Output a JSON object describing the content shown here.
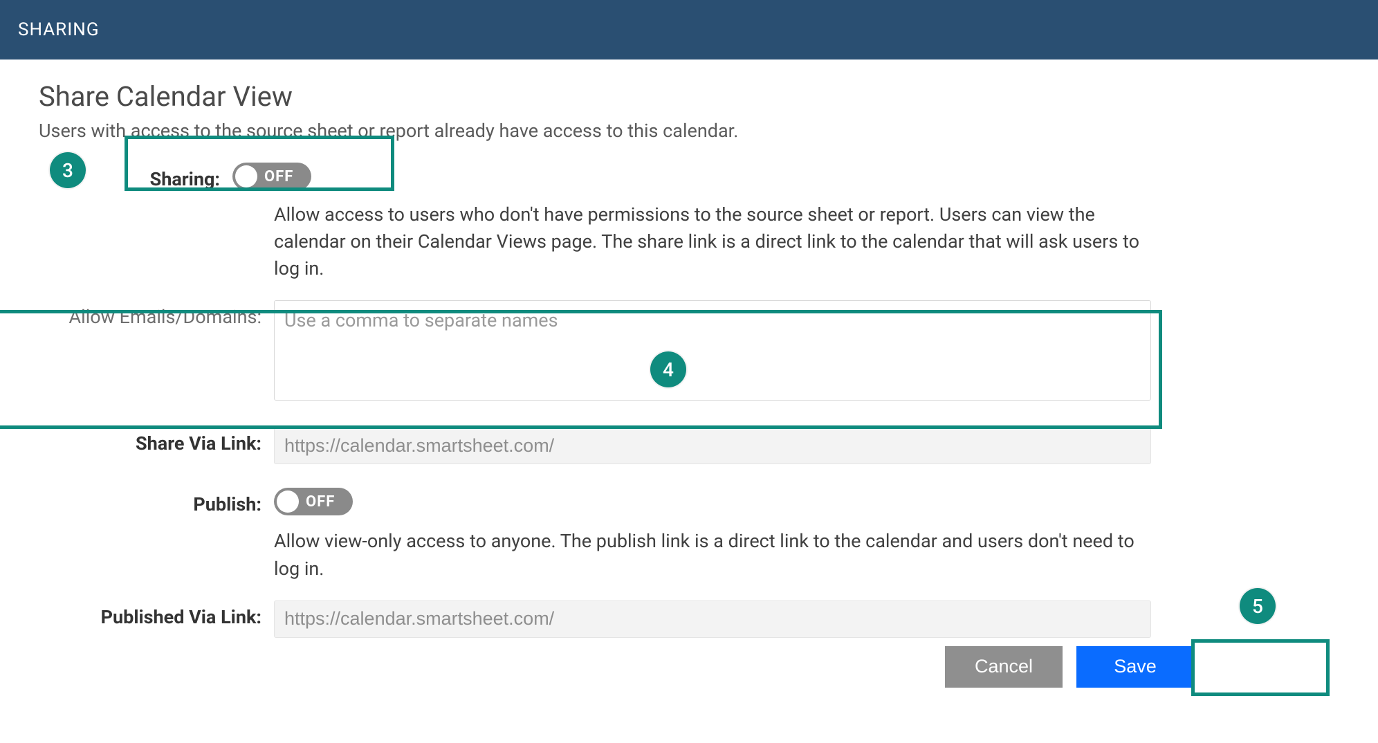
{
  "header": {
    "tab": "SHARING"
  },
  "title": "Share Calendar View",
  "subtitle": "Users with access to the source sheet or report already have access to this calendar.",
  "sharing": {
    "label": "Sharing:",
    "toggle": "OFF",
    "desc": "Allow access to users who don't have permissions to the source sheet or report. Users can view the calendar on their Calendar Views page. The share link is a direct link to the calendar that will ask users to log in."
  },
  "allow": {
    "label": "Allow Emails/Domains:",
    "placeholder": "Use a comma to separate names",
    "value": ""
  },
  "shareLink": {
    "label": "Share Via Link:",
    "value": "https://calendar.smartsheet.com/"
  },
  "publish": {
    "label": "Publish:",
    "toggle": "OFF",
    "desc": "Allow view-only access to anyone. The publish link is a direct link to the calendar and users don't need to log in."
  },
  "publishedLink": {
    "label": "Published Via Link:",
    "value": "https://calendar.smartsheet.com/"
  },
  "buttons": {
    "cancel": "Cancel",
    "save": "Save"
  },
  "annotations": {
    "n3": "3",
    "n4": "4",
    "n5": "5"
  },
  "colors": {
    "accent": "#0f8b7e",
    "primary": "#0a6cff",
    "headerBg": "#2a4f72",
    "muted": "#8f8f8f"
  }
}
